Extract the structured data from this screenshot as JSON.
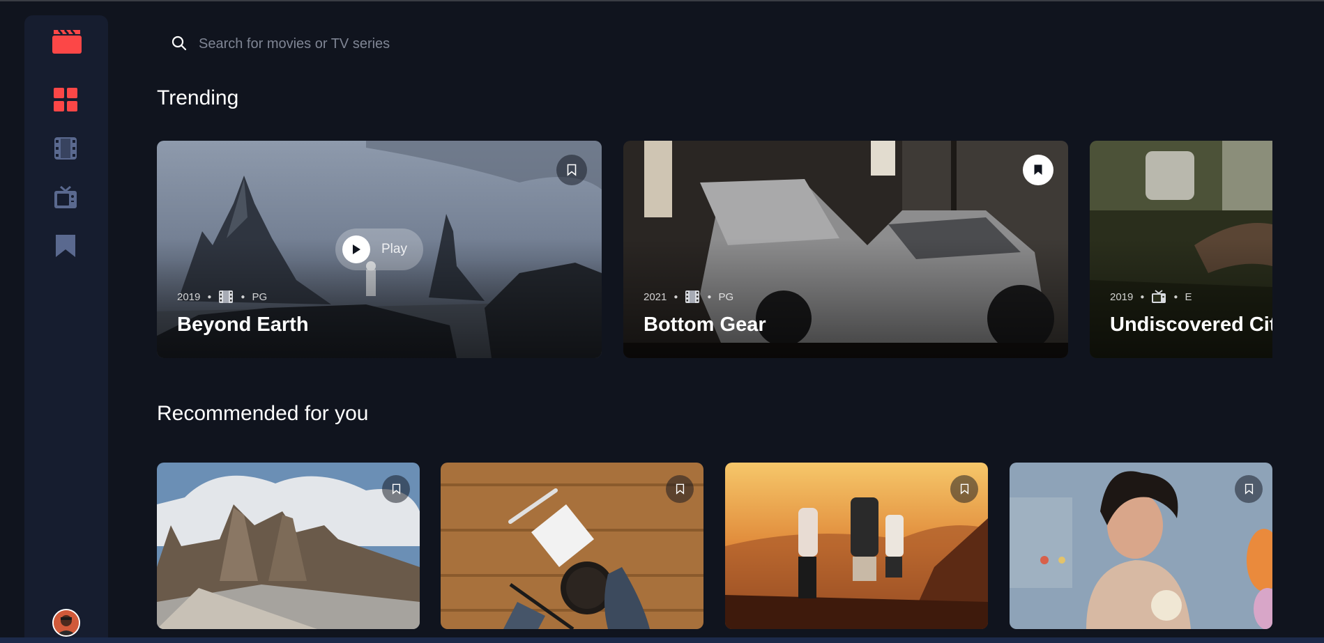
{
  "search": {
    "placeholder": "Search for movies or TV series",
    "value": ""
  },
  "sections": {
    "trending": "Trending",
    "recommended": "Recommended for you"
  },
  "nav": {
    "items": [
      {
        "name": "home",
        "icon": "grid-icon",
        "active": true
      },
      {
        "name": "movies",
        "icon": "film-icon",
        "active": false
      },
      {
        "name": "tv-series",
        "icon": "tv-icon",
        "active": false
      },
      {
        "name": "bookmarks",
        "icon": "bookmark-icon",
        "active": false
      }
    ]
  },
  "trending": [
    {
      "year": "2019",
      "category_icon": "film-icon",
      "rating": "PG",
      "title": "Beyond Earth",
      "bookmarked": false,
      "play_label": "Play"
    },
    {
      "year": "2021",
      "category_icon": "film-icon",
      "rating": "PG",
      "title": "Bottom Gear",
      "bookmarked": true
    },
    {
      "year": "2019",
      "category_icon": "tv-icon",
      "rating": "E",
      "title": "Undiscovered Cities",
      "bookmarked": false
    }
  ],
  "recommended": [
    {
      "bookmarked": false
    },
    {
      "bookmarked": false
    },
    {
      "bookmarked": false
    },
    {
      "bookmarked": false
    }
  ],
  "colors": {
    "background": "#10141e",
    "sidebar": "#161d2f",
    "accent_red": "#fc4747",
    "nav_inactive": "#5a698f",
    "text": "#ffffff"
  }
}
